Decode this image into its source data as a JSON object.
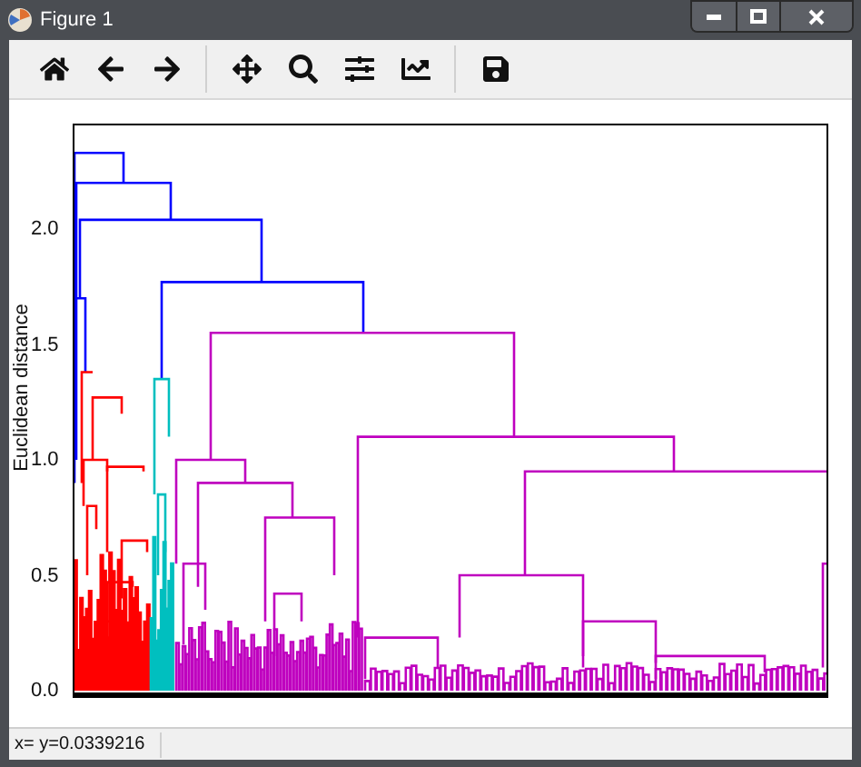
{
  "window": {
    "title": "Figure 1"
  },
  "plot": {
    "ylabel": "Euclidean distance",
    "yticks": [
      "2.0",
      "1.5",
      "1.0",
      "0.5",
      "0.0"
    ]
  },
  "status_bar": {
    "text": "x= y=0.0339216"
  }
}
